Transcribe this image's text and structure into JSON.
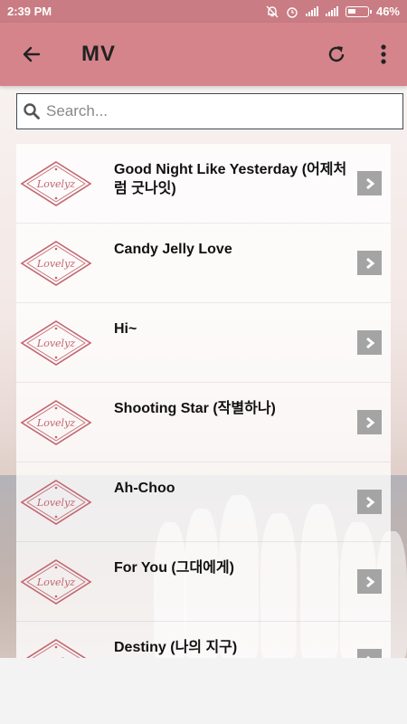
{
  "status_bar": {
    "time": "2:39 PM",
    "battery": "46%"
  },
  "toolbar": {
    "title": "MV"
  },
  "search": {
    "placeholder": "Search..."
  },
  "videos": [
    {
      "title": "Good Night Like Yesterday (어제처럼 굿나잇)",
      "logo": "Lovelyz"
    },
    {
      "title": "Candy Jelly Love",
      "logo": "Lovelyz"
    },
    {
      "title": "Hi~",
      "logo": "Lovelyz"
    },
    {
      "title": "Shooting Star (작별하나)",
      "logo": "Lovelyz"
    },
    {
      "title": "Ah-Choo",
      "logo": "Lovelyz"
    },
    {
      "title": "For You (그대에게)",
      "logo": "Lovelyz"
    },
    {
      "title": "Destiny (나의 지구)",
      "logo": "Lovelyz"
    }
  ],
  "colors": {
    "status_bar": "#c97c83",
    "toolbar": "#d5848b",
    "logo": "#c2656f",
    "arrow": "#a4a4a4"
  },
  "icons": {
    "back": "arrow-left-icon",
    "refresh": "refresh-icon",
    "menu": "more-vert-icon",
    "search": "magnifier-icon",
    "row": "chevron-right-icon"
  }
}
